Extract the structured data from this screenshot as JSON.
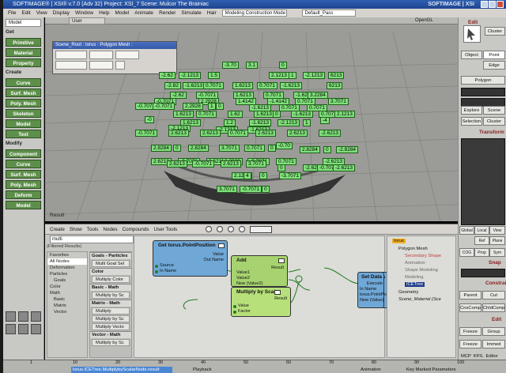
{
  "window": {
    "title": "SOFTIMAGE® | XSI® v.7.0 (Adv 32) Project: XSI_7    Scene: Mulcor The Brainiac",
    "watermark": "SOFTIMAGE | XSI"
  },
  "menubar": {
    "items": [
      "File",
      "Edit",
      "View",
      "Display",
      "Window",
      "Help",
      "Model",
      "Animate",
      "Render",
      "Simulate",
      "Hair"
    ],
    "mode_combo": "Modeling Construction Mode",
    "pass_combo": "Default_Pass"
  },
  "left_panel": {
    "top_combo": "Model",
    "sections": [
      {
        "header": "Get",
        "buttons": [
          "Primitive",
          "Material",
          "Property"
        ]
      },
      {
        "header": "Create",
        "buttons": [
          "Curve",
          "Surf. Mesh",
          "Poly. Mesh",
          "Skeleton",
          "Model",
          "Text"
        ]
      },
      {
        "header": "Modify",
        "buttons": [
          "Component",
          "Curve",
          "Surf. Mesh",
          "Poly. Mesh",
          "Deform",
          "Model"
        ]
      }
    ]
  },
  "viewport": {
    "camera": "User",
    "shading": "OpenGL",
    "result_label": "Result",
    "float_title": "Scene_Root : torus : Polygon Mesh :",
    "labels": [
      "-3.70",
      "3.1",
      "0",
      "-2.62",
      "-2.1213",
      "1.5",
      "2.1213",
      "1",
      "-2.1213",
      "6213",
      "-2.82",
      "-1.6213",
      "0.7071",
      "1.6213",
      "0.7071",
      "-1.6213",
      "6213",
      "-2.62",
      "-0.7071",
      "1.6213",
      "0.7071",
      "-1.6213",
      "3.2284",
      "-0.7071",
      "2.2928",
      "1.4142",
      "-1.4142",
      "0.7071",
      "3.7071",
      "-0.7071",
      "-0.7071",
      "2.2928",
      "1",
      "0",
      "-1.6213",
      "0.7071",
      "0.7071",
      "1.6213",
      "0.7071",
      "1.62",
      "1.6213",
      "0",
      "-1.6213",
      "0.7071",
      "2.1213",
      "-0",
      "1.6213",
      "1.2",
      "-1.6213",
      "-2.1213",
      "1",
      "-2.1213",
      "-2.1213",
      "-1.6213",
      "-4",
      "-0.7071",
      "2.6213",
      "2.6213",
      "0.7071",
      "2.6213",
      "2.6213",
      "-2.6213",
      "2.8284",
      "0",
      "2.8284",
      "3.7071",
      "0.7071",
      "0",
      "-0.70",
      "2.8284",
      "0",
      "-2.8284",
      "2.6213",
      "-0.7071",
      "2.6213",
      "2.2929",
      "-0.7071",
      "0.7071",
      "-2.6213",
      "2.6213",
      "-0.7071",
      "2.6213",
      "3.7071",
      "0",
      "-2.6213",
      "-0.7071",
      "-2.6213",
      "2.1213",
      "4",
      "0",
      "-3.7071",
      "3.7071",
      "-0.7071",
      "0"
    ]
  },
  "right_panel": {
    "buttons": [
      "Cluster",
      "Object",
      "Point",
      "Edge",
      "Polygon",
      "Explore",
      "Scene",
      "Selection",
      "Cluster"
    ],
    "headers": [
      "Edit",
      "Transform",
      "Snap",
      "Constrain",
      "Edit"
    ],
    "bottom_buttons": [
      "Global",
      "Local",
      "View",
      "Ref",
      "Plane",
      "COG",
      "Prop",
      "Sym",
      "Parent",
      "Cut",
      "CnsComp",
      "ChldComp",
      "Freeze",
      "Group",
      "Freeze",
      "Immed"
    ],
    "mcp_tabs": [
      "MCP",
      "KP/L",
      "Editor"
    ]
  },
  "render_tree": {
    "menus": [
      "Create",
      "Show",
      "Tools",
      "Nodes",
      "Compounds",
      "User Tools"
    ],
    "filter_value": "multi",
    "filtered_label": "(Filtered Results)",
    "categories": [
      "Favorites",
      "All Nodes",
      "Deformation",
      "Particles",
      "Goals",
      "Color",
      "Math",
      "Basic",
      "Matrix",
      "Vector"
    ],
    "node_list": [
      {
        "header": "Goals - Particles",
        "items": [
          "Multi Goal Sel"
        ]
      },
      {
        "header": "Color",
        "items": [
          "Multiply Color"
        ]
      },
      {
        "header": "Basic - Math",
        "items": [
          "Multiply by Sc"
        ]
      },
      {
        "header": "Matrix - Math",
        "items": [
          "Multiply",
          "Multiply by Sc",
          "Multiply Vecto"
        ]
      },
      {
        "header": "Vector - Math",
        "items": [
          "Multiply by Sc"
        ]
      }
    ],
    "nodes": {
      "get_point": {
        "title": "Get torus.PointPosition",
        "ports": [
          "Value",
          "Out Name",
          "Source",
          "In Name"
        ]
      },
      "add": {
        "title": "Add",
        "ports": [
          "Result",
          "Value1",
          "Value2",
          "New (Value2)"
        ]
      },
      "multiply": {
        "title": "Multiply by Scalar",
        "ports": [
          "Result",
          "Value",
          "Factor"
        ]
      },
      "set_data": {
        "title": "Set Data",
        "ports": [
          "Execute",
          "In Name",
          "torus.PointPosition",
          "New (Value)"
        ]
      }
    },
    "explorer": {
      "root": "torus",
      "items": [
        "Polygon Mesh",
        "Secondary Shape",
        "Animation",
        "Shape Modeling",
        "Modeling",
        "ICETree",
        "Geometry",
        "Scene_Material (Sce"
      ]
    }
  },
  "timeline": {
    "status_text": "torus.ICETree.MultiplybyScalarNode.result",
    "ticks": [
      "1",
      "10",
      "20",
      "30",
      "40",
      "50",
      "60",
      "70",
      "80",
      "90",
      "100"
    ],
    "bottom_labels": [
      "Playback",
      "Animation",
      "Key Marked Parameters"
    ]
  },
  "colors": {
    "node_green": "#7fe07a",
    "panel_button_green": "#5d8f4a",
    "get_node_blue": "#6fa7d6",
    "add_node_green": "#a6d36f",
    "multiply_node_green": "#b7e07a",
    "set_node_blue": "#6fa7d6"
  }
}
